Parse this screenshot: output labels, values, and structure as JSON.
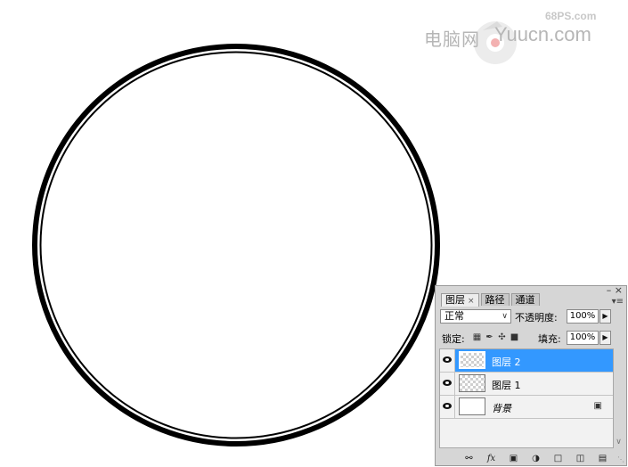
{
  "watermark": {
    "site": "68PS.com",
    "cn": "电脑网",
    "en": "Yuucn.com",
    "logo_icon": "watermark-logo-icon"
  },
  "canvas": {
    "shape": "circle-ring",
    "stroke_color": "#000000",
    "dash_color": "#ffffff",
    "background": "#ffffff"
  },
  "layers_panel": {
    "tabs": [
      {
        "label": "图层",
        "close": "×",
        "active": true
      },
      {
        "label": "路径",
        "active": false
      },
      {
        "label": "通道",
        "active": false
      }
    ],
    "minimize_glyph": "–",
    "close_glyph": "×",
    "menu_glyph": "▾≡",
    "blend_mode": "正常",
    "opacity_label": "不透明度:",
    "opacity_value": "100%",
    "lock_label": "锁定:",
    "fill_label": "填充:",
    "fill_value": "100%",
    "lock_icons": [
      "lock-transparent-icon",
      "lock-image-icon",
      "lock-position-icon",
      "lock-all-icon"
    ],
    "layers": [
      {
        "name": "图层 2",
        "selected": true,
        "thumb": "transparent"
      },
      {
        "name": "图层 1",
        "selected": false,
        "thumb": "transparent"
      },
      {
        "name": "背景",
        "selected": false,
        "thumb": "white",
        "locked": true
      }
    ],
    "bottom_icons": [
      "link-icon",
      "fx-icon",
      "mask-icon",
      "adjustment-icon",
      "group-folder-icon",
      "new-layer-icon",
      "trash-icon"
    ],
    "accent": "#3398ff"
  }
}
